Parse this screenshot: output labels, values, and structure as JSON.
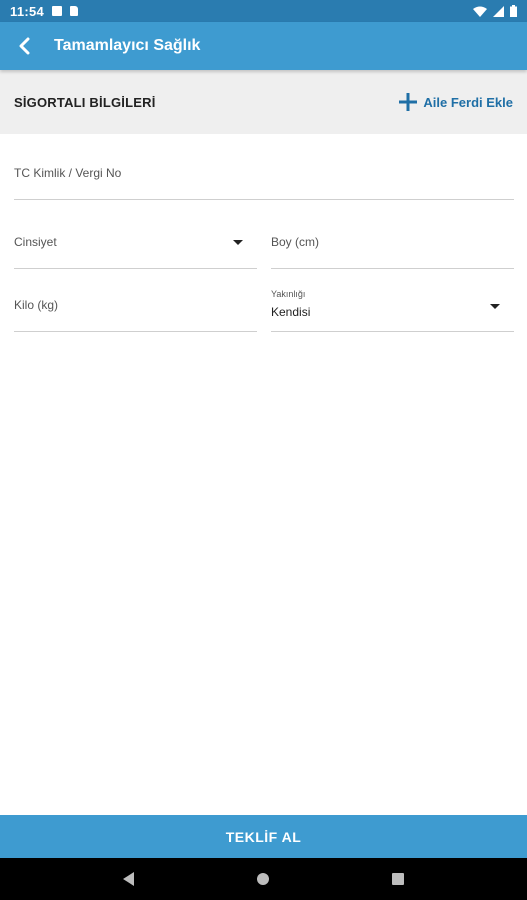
{
  "status_bar": {
    "time": "11:54"
  },
  "app_bar": {
    "title": "Tamamlayıcı Sağlık"
  },
  "section": {
    "title": "SİGORTALI BİLGİLERİ",
    "add_label": "Aile Ferdi Ekle"
  },
  "form": {
    "tc_placeholder": "TC Kimlik / Vergi No",
    "gender_placeholder": "Cinsiyet",
    "height_placeholder": "Boy (cm)",
    "weight_placeholder": "Kilo (kg)",
    "relation_label": "Yakınlığı",
    "relation_value": "Kendisi"
  },
  "bottom": {
    "button_label": "TEKLİF AL"
  },
  "colors": {
    "status_bar": "#2a7cb0",
    "app_bar": "#3e9bd0",
    "accent": "#1f6fa6"
  }
}
